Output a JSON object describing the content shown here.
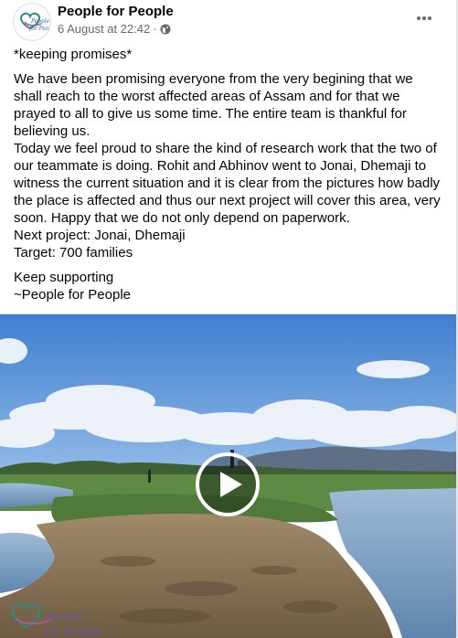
{
  "post": {
    "page_name": "People for People",
    "timestamp": "6 August at 22:42",
    "separator": "·",
    "privacy_icon": "globe-icon",
    "more_icon": "more-options-icon",
    "avatar_icon": "page-logo-avatar",
    "body": {
      "line_1": "*keeping promises*",
      "line_2": "We have been promising everyone from the very begining that we shall reach to the worst affected areas of Assam and for that we prayed to all to give us some time. The entire team is thankful for believing us.",
      "line_3": "Today we feel proud to share the kind of research work that the two of our teammate is doing. Rohit and Abhinov went to Jonai, Dhemaji to witness the current situation and it is clear from the pictures how badly the place is affected and thus our next project will cover this area, very soon. Happy that we do not only depend on paperwork.",
      "line_4": "Next project: Jonai, Dhemaji",
      "line_5": "Target: 700 families",
      "line_6": "Keep supporting",
      "line_7": "~People for People"
    },
    "media": {
      "type": "video",
      "play_icon": "play-icon",
      "watermark_icon": "page-logo-watermark"
    }
  },
  "colors": {
    "text_primary": "#050505",
    "text_secondary": "#65676b",
    "sky": "#4f8fd6",
    "water": "#7fa6c9",
    "mud": "#8b7355",
    "grass": "#4f7a3a"
  }
}
